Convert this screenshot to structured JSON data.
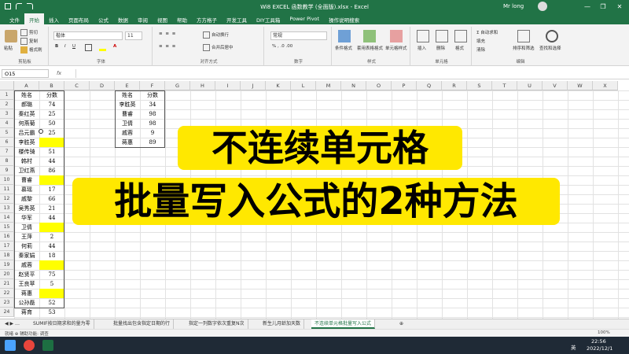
{
  "window": {
    "title": "Wi8 EXCEL 函数教学 (全面版).xlsx - Excel",
    "user": "Mr long",
    "controls": [
      "—",
      "❐",
      "✕"
    ]
  },
  "tabs": [
    "文件",
    "开始",
    "插入",
    "页面布局",
    "公式",
    "数据",
    "审阅",
    "视图",
    "帮助",
    "方方格子",
    "开发工具",
    "DIY工具箱",
    "Power Pivot",
    "操作说明搜索"
  ],
  "active_tab": "开始",
  "ribbon": {
    "clipboard": {
      "paste": "粘贴",
      "cut": "剪切",
      "copy": "复制",
      "format_painter": "格式刷",
      "label": "剪贴板"
    },
    "font": {
      "name": "楷体",
      "size": "11",
      "label": "字体"
    },
    "alignment": {
      "wrap": "自动换行",
      "merge": "合并后居中",
      "label": "对齐方式"
    },
    "number": {
      "format": "常规",
      "label": "数字"
    },
    "styles": {
      "conditional": "条件格式",
      "table": "套用表格格式",
      "cell": "单元格样式",
      "label": "样式"
    },
    "cells": {
      "insert": "插入",
      "delete": "删除",
      "format": "格式",
      "label": "单元格"
    },
    "editing": {
      "sum": "Σ 自动求和",
      "fill": "填充",
      "clear": "清除",
      "sort": "排序和筛选",
      "find": "查找和选择",
      "label": "编辑"
    }
  },
  "formula_bar": {
    "name_box": "O15",
    "fx": "fx",
    "content": ""
  },
  "columns": [
    "A",
    "B",
    "C",
    "D",
    "E",
    "F",
    "G",
    "H",
    "I",
    "J",
    "K",
    "L",
    "M",
    "N",
    "O",
    "P",
    "Q",
    "R",
    "S",
    "T",
    "U",
    "V",
    "W",
    "X"
  ],
  "rows": [
    "1",
    "2",
    "3",
    "4",
    "5",
    "6",
    "7",
    "8",
    "9",
    "10",
    "11",
    "12",
    "13",
    "14",
    "15",
    "16",
    "17",
    "18",
    "19",
    "20",
    "21",
    "22",
    "23",
    "24"
  ],
  "table_left": {
    "headers": [
      "姓名",
      "分数"
    ],
    "rows": [
      [
        "郝璐",
        "74",
        false
      ],
      [
        "秦红英",
        "25",
        false
      ],
      [
        "何燕菊",
        "50",
        false
      ],
      [
        "吕元霸",
        "25",
        false
      ],
      [
        "李胜英",
        "",
        true
      ],
      [
        "楼传骑",
        "51",
        false
      ],
      [
        "韩村",
        "44",
        false
      ],
      [
        "卫红燕",
        "86",
        false
      ],
      [
        "曹睿",
        "",
        true
      ],
      [
        "慕瑶",
        "17",
        false
      ],
      [
        "戚黎",
        "66",
        false
      ],
      [
        "吴秀英",
        "21",
        false
      ],
      [
        "华军",
        "44",
        false
      ],
      [
        "卫倩",
        "",
        true
      ],
      [
        "王萍",
        "2",
        false
      ],
      [
        "何莉",
        "44",
        false
      ],
      [
        "秦家娟",
        "18",
        false
      ],
      [
        "戚蓉",
        "",
        true
      ],
      [
        "赵贤平",
        "75",
        false
      ],
      [
        "王良苹",
        "5",
        false
      ],
      [
        "蒋惠",
        "",
        true
      ],
      [
        "公孙磊",
        "52",
        false
      ],
      [
        "蒋育",
        "53",
        false
      ]
    ]
  },
  "table_right": {
    "headers": [
      "姓名",
      "分数"
    ],
    "rows": [
      [
        "李胜英",
        "34"
      ],
      [
        "曹睿",
        "98"
      ],
      [
        "卫倩",
        "98"
      ],
      [
        "戚蓉",
        "9"
      ],
      [
        "蒋惠",
        "89"
      ]
    ]
  },
  "overlay": {
    "line1": "不连续单元格",
    "line2": "批量写入公式的2种方法"
  },
  "sheet_tabs": [
    {
      "label": "SUMIF按日期求和的量为零",
      "active": false
    },
    {
      "label": "批量找出包含指定日期的行",
      "active": false
    },
    {
      "label": "指定一列数字依次重复N次",
      "active": false
    },
    {
      "label": "新生儿月龄加天数",
      "active": false
    },
    {
      "label": "不连续单元格批量写入公式",
      "active": true
    }
  ],
  "status": {
    "left": "就绪  ⊕ 辅助功能: 调查",
    "zoom": "100%"
  },
  "taskbar": {
    "time": "22:56",
    "date": "2022/12/1",
    "ime": "英"
  },
  "colors": {
    "excel_green": "#217346",
    "highlight": "#ffff00",
    "overlay_bg": "#ffe800"
  }
}
